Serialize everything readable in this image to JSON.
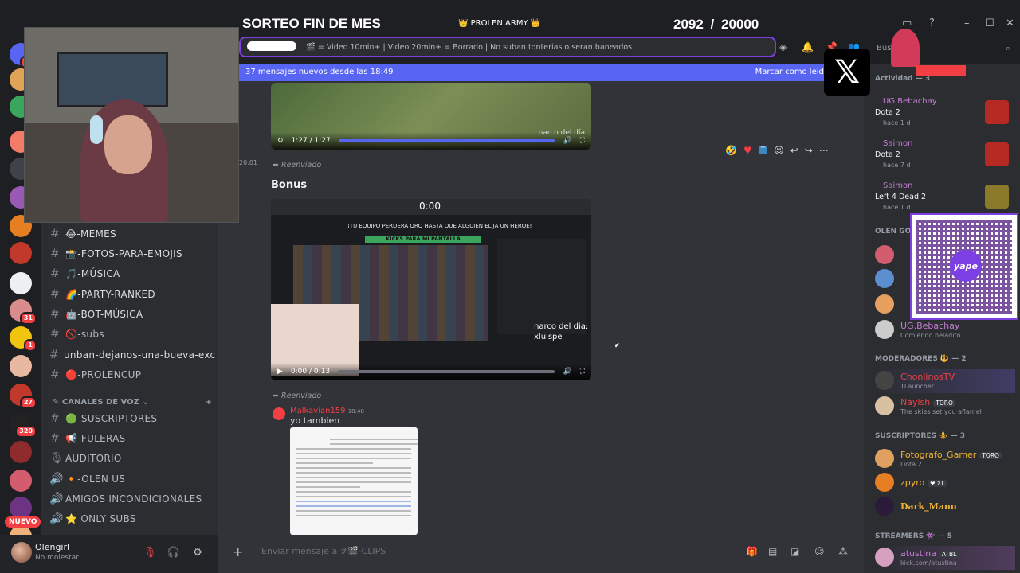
{
  "overlay": {
    "title": "SORTEO FIN DE MES",
    "army_label": "👑 PROLEN ARMY 👑",
    "counter": "2092  / 20000"
  },
  "channel_header": {
    "topic": "🎬 = Video 10min+ | Video 20min+ = Borrado | No suban tonterias o seran baneados",
    "search_placeholder": "Busc"
  },
  "new_messages_bar": {
    "text": "37 mensajes nuevos desde las 18:49",
    "mark_read": "Marcar como leído"
  },
  "channels": [
    {
      "label": "😂-MEMES"
    },
    {
      "label": "📸-FOTOS-PARA-EMOJIS"
    },
    {
      "label": "🎵-MÚSICA"
    },
    {
      "label": "🌈-PARTY-RANKED"
    },
    {
      "label": "🤖-BOT-MÚSICA"
    },
    {
      "label": "🚫-subs"
    },
    {
      "label": "unban-dejanos-una-bueva-exc..."
    },
    {
      "label": "🔴-PROLENCUP"
    }
  ],
  "voice_category": "CANALES DE VOZ",
  "voice_channels": [
    {
      "label": "🟢-SUSCRIPTORES",
      "icon": "#"
    },
    {
      "label": "📢-FULERAS",
      "icon": "#"
    },
    {
      "label": "AUDITORIO",
      "icon": "🎙"
    },
    {
      "label": "🔸-OLEN US",
      "icon": "🔊"
    },
    {
      "label": "AMIGOS INCONDICIONALES",
      "icon": "🔊"
    },
    {
      "label": "⭐ ONLY SUBS",
      "icon": "🔊"
    }
  ],
  "server_badges": [
    "14",
    "31",
    "1",
    "27",
    "320"
  ],
  "new_label": "NUEVO",
  "user": {
    "name": "Olengirl",
    "status": "No molestar"
  },
  "chat": {
    "video1_time": "1:27 / 1:27",
    "video1_progress": 1.0,
    "video1_caption": "narco del día",
    "timestamp": "20:01",
    "forwarded": "Reenviado",
    "bonus": "Bonus",
    "video2_time": "0:00 / 0:13",
    "video2_progress": 0.0,
    "video2_timer": "0:00",
    "video2_banner": "¡TU EQUIPO PERDERÁ ORO HASTA QUE ALGUIEN ELIJA UN HÉROE!",
    "video2_kicks": "KICKS PARA MI PANTALLA",
    "video2_caption": "narco del dia:\nxluispe",
    "forwarded2": "Reenviado",
    "author": "Malkavian159",
    "author_time": "18:48",
    "message": "yo tambien"
  },
  "composer_placeholder": "Enviar mensaje a #🎬-CLIPS",
  "members": {
    "activity_header": "Actividad — 3",
    "activities": [
      {
        "name": "UG.Bebachay",
        "game": "Dota 2",
        "time": "hace 1 d"
      },
      {
        "name": "Saimon",
        "game": "Dota 2",
        "time": "hace 7 d"
      },
      {
        "name": "Saimon",
        "game": "Left 4 Dead 2",
        "time": "hace 1 d"
      }
    ],
    "group_partial": "OLEN GO",
    "group_member": {
      "name": "UG.Bebachay",
      "sub": "Comiendo heladito"
    },
    "mods_header": "MODERADORES 🔱 — 2",
    "mods": [
      {
        "name": "ChonlinosTV",
        "sub": "TLauncher",
        "color": "#f23f43"
      },
      {
        "name": "Nayish",
        "badge": "TORO",
        "sub": "The skies set you aflamel",
        "color": "#f23f43"
      }
    ],
    "subs_header": "SUSCRIPTORES ⚜️ — 3",
    "subs": [
      {
        "name": "Fotografo_Gamer",
        "badge": "TORO",
        "sub": "Dota 2",
        "color": "#f0b232"
      },
      {
        "name": "zpyro",
        "badge": "❤ z1",
        "sub": "",
        "color": "#f0b232"
      },
      {
        "name": "Dark_Manu",
        "sub": "",
        "color": "#f0b232"
      }
    ],
    "streamers_header": "STREAMERS 👾 — 5",
    "streamers": [
      {
        "name": "atustina",
        "badge": "ATBL",
        "sub": "kick.com/atustina",
        "color": "#c67bd6"
      }
    ]
  },
  "colors": {
    "accent": "#5865f2",
    "overlay_purple": "#7b3fe4",
    "danger": "#f23f43"
  }
}
